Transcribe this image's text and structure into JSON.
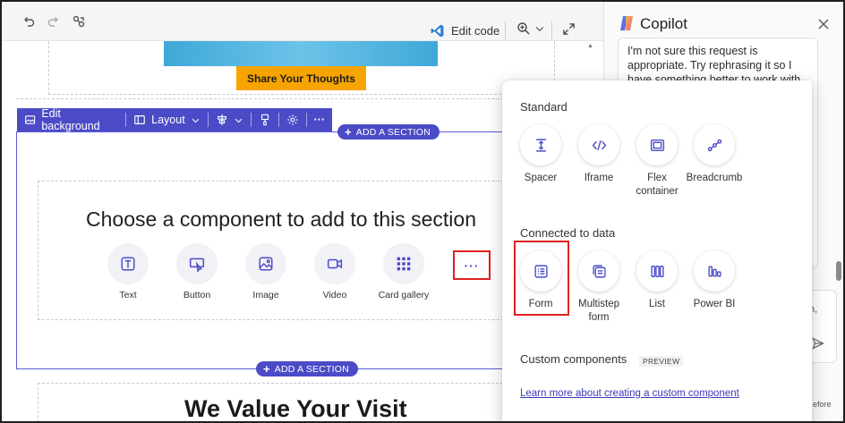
{
  "toolbar": {
    "undo_icon": "undo-icon",
    "redo_icon": "redo-icon",
    "link_icon": "link-icon",
    "edit_code_label": "Edit code",
    "zoom_icon": "zoom-icon",
    "expand_icon": "expand-icon"
  },
  "page": {
    "share_button_label": "Share Your Thoughts",
    "section_toolbar": {
      "edit_background": "Edit background",
      "layout": "Layout",
      "more": "···"
    },
    "add_section_label": "ADD A SECTION",
    "choose_title": "Choose a component to add to this section",
    "components": [
      {
        "label": "Text",
        "icon": "text-icon"
      },
      {
        "label": "Button",
        "icon": "button-icon"
      },
      {
        "label": "Image",
        "icon": "image-icon"
      },
      {
        "label": "Video",
        "icon": "video-icon"
      },
      {
        "label": "Card gallery",
        "icon": "card-gallery-icon"
      }
    ],
    "more_label": "···",
    "value_title": "We Value Your Visit"
  },
  "copilot": {
    "title": "Copilot",
    "message": "I'm not sure this request is appropriate. Try rephrasing it so I have something better to work with or start over with one",
    "input_fragment": "n,",
    "footer_fragment": "efore"
  },
  "flyout": {
    "standard_heading": "Standard",
    "standard_items": [
      {
        "label": "Spacer",
        "icon": "spacer-icon"
      },
      {
        "label": "Iframe",
        "icon": "code-icon"
      },
      {
        "label": "Flex container",
        "icon": "flex-container-icon"
      },
      {
        "label": "Breadcrumb",
        "icon": "breadcrumb-icon"
      }
    ],
    "data_heading": "Connected to data",
    "data_items": [
      {
        "label": "Form",
        "icon": "form-icon"
      },
      {
        "label": "Multistep form",
        "icon": "multistep-form-icon"
      },
      {
        "label": "List",
        "icon": "list-icon"
      },
      {
        "label": "Power BI",
        "icon": "power-bi-icon"
      }
    ],
    "custom_heading": "Custom components",
    "preview_badge": "PREVIEW",
    "learn_link": "Learn more about creating a custom component"
  }
}
